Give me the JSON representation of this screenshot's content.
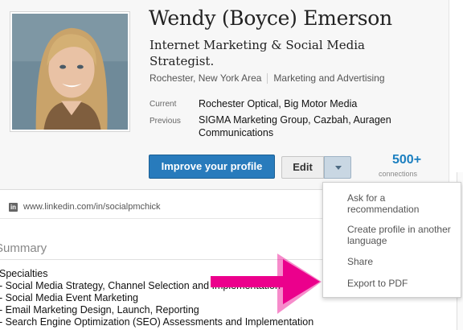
{
  "profile": {
    "name": "Wendy (Boyce) Emerson",
    "headline": "Internet Marketing & Social Media Strategist.",
    "location": "Rochester, New York Area",
    "industry": "Marketing and Advertising",
    "current_label": "Current",
    "current_value": "Rochester Optical, Big Motor Media",
    "previous_label": "Previous",
    "previous_value": "SIGMA Marketing Group, Cazbah, Auragen Communications"
  },
  "actions": {
    "improve_label": "Improve your profile",
    "edit_label": "Edit",
    "connections_count": "500+",
    "connections_label": "connections"
  },
  "url": {
    "icon_text": "in",
    "text": "www.linkedin.com/in/socialpmchick"
  },
  "summary": {
    "title": "Summary",
    "lines": [
      "Specialties",
      "- Social Media Strategy, Channel Selection and Implementation",
      "- Social Media Event Marketing",
      "- Email Marketing Design, Launch, Reporting",
      "- Search Engine Optimization (SEO) Assessments and Implementation"
    ]
  },
  "dropdown": {
    "items": [
      "Ask for a recommendation",
      "Create profile in another language",
      "Share",
      "Export to PDF"
    ]
  },
  "colors": {
    "primary_button": "#287bbc",
    "connections": "#1b7fc0",
    "annotation_arrow": "#ec008c"
  }
}
